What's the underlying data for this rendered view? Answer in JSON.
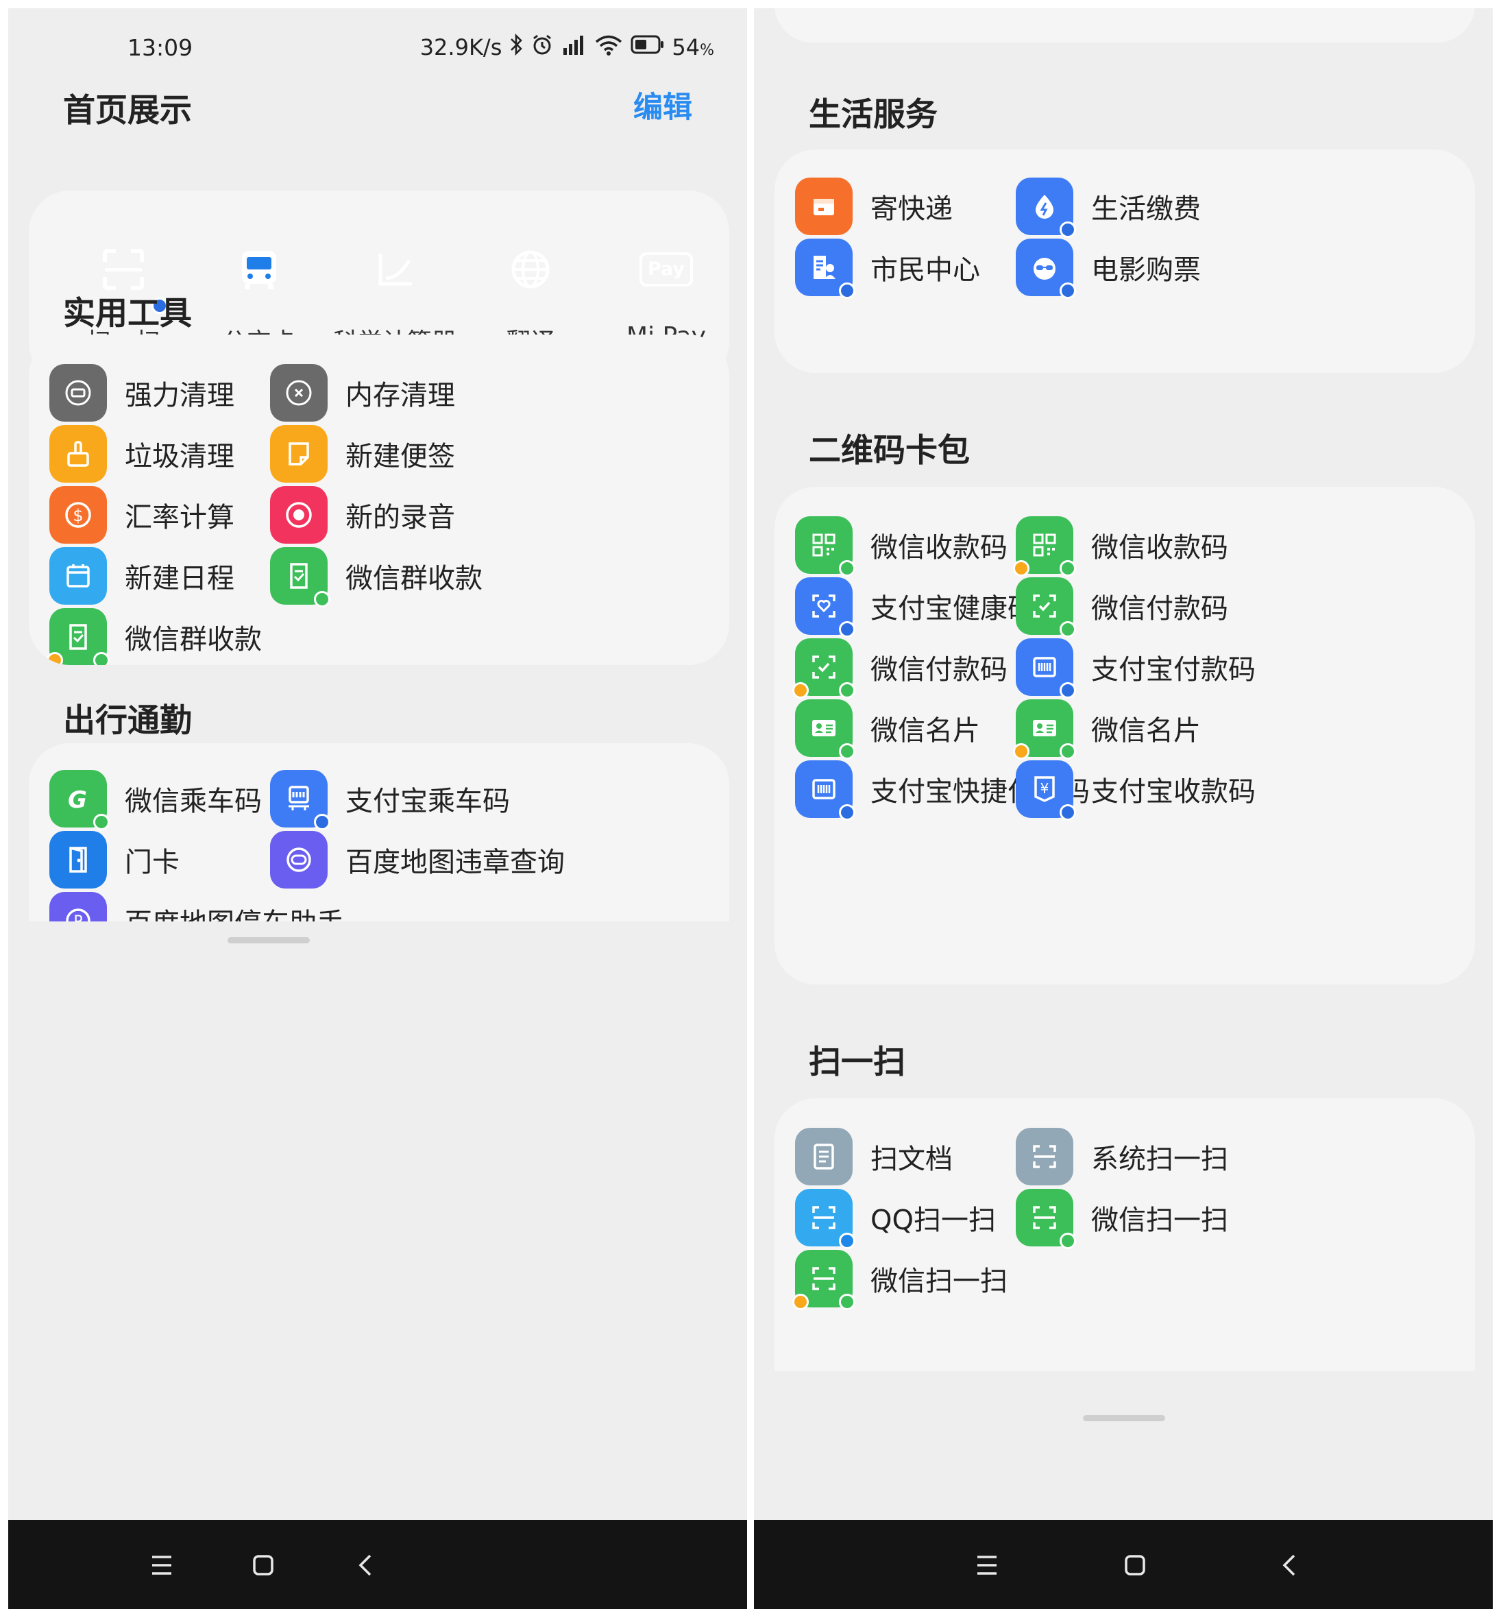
{
  "status": {
    "time": "13:09",
    "speed": "32.9K/s",
    "battery": "54",
    "battery_unit": "%",
    "battery_level": 0.54
  },
  "home": {
    "title": "首页展示",
    "edit": "编辑",
    "tiles": [
      {
        "label": "扫一扫",
        "icon": "scan-icon",
        "color": "#3d7cf5"
      },
      {
        "label": "公交卡",
        "icon": "bus-icon",
        "color": "#1f7ee8"
      },
      {
        "label": "科学计算器",
        "icon": "calculator-icon",
        "color": "#f7702b"
      },
      {
        "label": "翻译",
        "icon": "globe-icon",
        "color": "#93a8b7"
      },
      {
        "label": "Mi Pay",
        "icon": "mipay-icon",
        "color": "#f0412c",
        "icon_text": "Pay"
      }
    ]
  },
  "tools": {
    "title": "实用工具",
    "items": [
      {
        "label": "强力清理",
        "icon": "deep-clean-icon",
        "color": "#6a6a6a"
      },
      {
        "label": "内存清理",
        "icon": "memory-clean-icon",
        "color": "#6a6a6a"
      },
      {
        "label": "垃圾清理",
        "icon": "broom-icon",
        "color": "#f9a81b"
      },
      {
        "label": "新建便签",
        "icon": "note-icon",
        "color": "#f9a81b"
      },
      {
        "label": "汇率计算",
        "icon": "dollar-icon",
        "color": "#f7702b"
      },
      {
        "label": "新的录音",
        "icon": "record-icon",
        "color": "#f2335d"
      },
      {
        "label": "新建日程",
        "icon": "calendar-icon",
        "color": "#33aaf0"
      },
      {
        "label": "微信群收款",
        "icon": "wechat-group-pay-icon",
        "color": "#3cbf58"
      },
      {
        "label": "微信群收款",
        "icon": "wechat-group-pay-icon",
        "color": "#3cbf58"
      }
    ]
  },
  "commute": {
    "title": "出行通勤",
    "items": [
      {
        "label": "微信乘车码",
        "icon": "wechat-ride-icon",
        "color": "#3cbf58"
      },
      {
        "label": "支付宝乘车码",
        "icon": "alipay-ride-icon",
        "color": "#3d7cf5"
      },
      {
        "label": "门卡",
        "icon": "door-card-icon",
        "color": "#1f7ee8"
      },
      {
        "label": "百度地图违章查询",
        "icon": "violation-query-icon",
        "color": "#6a5ef0"
      },
      {
        "label": "百度地图停车助手",
        "icon": "parking-icon",
        "color": "#6a5ef0"
      }
    ]
  },
  "life": {
    "title": "生活服务",
    "items": [
      {
        "label": "寄快递",
        "icon": "parcel-icon",
        "color": "#f7702b"
      },
      {
        "label": "生活缴费",
        "icon": "utility-icon",
        "color": "#3d7cf5"
      },
      {
        "label": "市民中心",
        "icon": "citizen-icon",
        "color": "#3d7cf5"
      },
      {
        "label": "电影购票",
        "icon": "movie-icon",
        "color": "#3d7cf5"
      }
    ]
  },
  "qr": {
    "title": "二维码卡包",
    "items": [
      {
        "label": "微信收款码",
        "icon": "qr-icon",
        "color": "#3cbf58"
      },
      {
        "label": "微信收款码",
        "icon": "qr-icon",
        "color": "#3cbf58"
      },
      {
        "label": "支付宝健康码",
        "icon": "health-code-icon",
        "color": "#3d7cf5"
      },
      {
        "label": "微信付款码",
        "icon": "pay-code-icon",
        "color": "#3cbf58"
      },
      {
        "label": "微信付款码",
        "icon": "pay-code-icon",
        "color": "#3cbf58"
      },
      {
        "label": "支付宝付款码",
        "icon": "barcode-icon",
        "color": "#3d7cf5"
      },
      {
        "label": "微信名片",
        "icon": "business-card-icon",
        "color": "#3cbf58"
      },
      {
        "label": "微信名片",
        "icon": "business-card-icon",
        "color": "#3cbf58"
      },
      {
        "label": "支付宝快捷付款码",
        "icon": "barcode-icon",
        "color": "#3d7cf5"
      },
      {
        "label": "支付宝收款码",
        "icon": "yuan-icon",
        "color": "#3d7cf5",
        "icon_text": "¥"
      }
    ]
  },
  "scan": {
    "title": "扫一扫",
    "items": [
      {
        "label": "扫文档",
        "icon": "document-icon",
        "color": "#93a8b7"
      },
      {
        "label": "系统扫一扫",
        "icon": "scan-icon",
        "color": "#93a8b7"
      },
      {
        "label": "QQ扫一扫",
        "icon": "scan-icon",
        "color": "#33aaf0"
      },
      {
        "label": "微信扫一扫",
        "icon": "scan-icon",
        "color": "#3cbf58"
      },
      {
        "label": "微信扫一扫",
        "icon": "scan-icon",
        "color": "#3cbf58"
      }
    ]
  },
  "nav": {
    "menu": "menu-icon",
    "home": "home-icon",
    "back": "back-icon"
  }
}
